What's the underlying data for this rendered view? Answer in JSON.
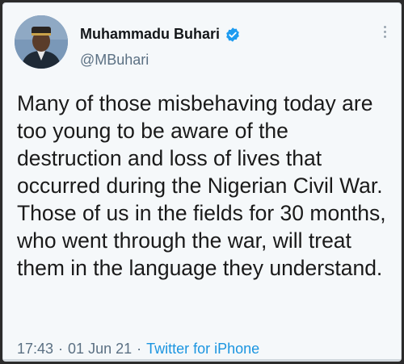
{
  "tweet": {
    "author": {
      "display_name": "Muhammadu Buhari",
      "handle": "@MBuhari",
      "verified": true,
      "avatar_icon": "profile-photo"
    },
    "text": "Many of those misbehaving today are too young to be aware of the destruction and loss of lives that occurred during the Nigerian Civil War. Those of us in the fields for 30 months, who went through the war, will treat them in the language they understand.",
    "time": "17:43",
    "date": "01 Jun 21",
    "source": "Twitter for iPhone",
    "separator": "·"
  },
  "colors": {
    "card_background": "#f5f8fa",
    "text_primary": "#14171a",
    "text_secondary": "#5b7083",
    "link_blue": "#1b95e0",
    "verified_blue": "#1d9bf0"
  }
}
